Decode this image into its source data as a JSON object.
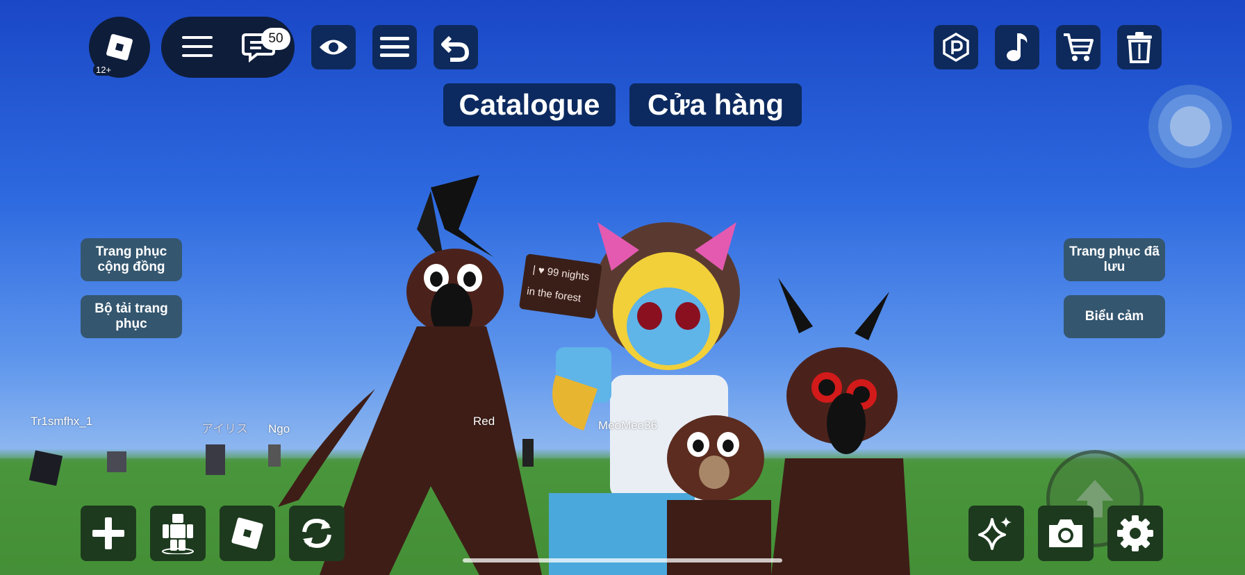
{
  "top_bar": {
    "logo_icon": "roblox-logo-icon",
    "age_rating": "12+",
    "menu_icon": "hamburger-icon",
    "chat_icon": "chat-icon",
    "chat_count": "50",
    "view_icon": "eye-icon",
    "list_icon": "list-icon",
    "undo_icon": "undo-icon",
    "right_icons": [
      "robux-icon",
      "music-note-icon",
      "cart-icon",
      "trash-icon"
    ]
  },
  "title_buttons": {
    "catalogue": "Catalogue",
    "shop": "Cửa hàng"
  },
  "left_panel": {
    "community_outfits": "Trang phục cộng đồng",
    "outfit_loader": "Bộ tải trang phục"
  },
  "right_panel": {
    "saved_outfits": "Trang phục đã lưu",
    "emotes": "Biểu cảm"
  },
  "player_names": {
    "p1": "Tr1smfhx_1",
    "p2": "アイリス",
    "p3": "Ngo",
    "p4": "Red",
    "p5": "MeoMeo36"
  },
  "sign_text": {
    "line1": "| ♥ 99 nights",
    "line2": "in the forest"
  },
  "bottom_left_icons": [
    "plus-icon",
    "avatar-icon",
    "roblox-logo-icon",
    "refresh-icon"
  ],
  "bottom_right_icons": [
    "sparkle-icon",
    "camera-icon",
    "gear-icon",
    "jump-arrow-icon"
  ],
  "colors": {
    "button_dark_blue": "#0e2a5c",
    "button_green_dark": "#1d3a1e",
    "side_button": "#34566f",
    "sky": "#2e6ae0",
    "grass": "#3f8a32"
  }
}
